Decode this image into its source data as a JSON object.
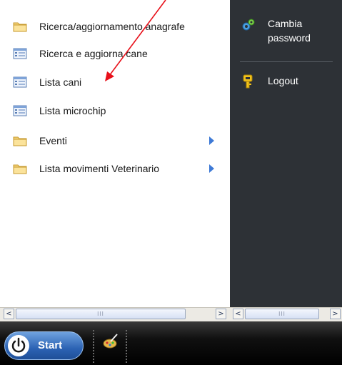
{
  "menu": {
    "items": [
      {
        "label": "Ricerca/aggiornamento anagrafe",
        "icon": "folder-icon",
        "submenu": false
      },
      {
        "label": "Ricerca e aggiorna cane",
        "icon": "list-window-icon",
        "submenu": false
      },
      {
        "label": "Lista cani",
        "icon": "list-window-icon",
        "submenu": false
      },
      {
        "label": "Lista microchip",
        "icon": "list-window-icon",
        "submenu": false
      },
      {
        "label": "Eventi",
        "icon": "folder-icon",
        "submenu": true
      },
      {
        "label": "Lista movimenti Veterinario",
        "icon": "folder-icon",
        "submenu": true
      }
    ]
  },
  "right_panel": {
    "change_password_label_line1": "Cambia",
    "change_password_label_line2": "password",
    "logout_label": "Logout"
  },
  "scrollbars": {
    "left_thumb_grip": "III",
    "right_thumb_grip": "III",
    "left_arrow": "<",
    "right_arrow": ">"
  },
  "taskbar": {
    "start_label": "Start"
  },
  "colors": {
    "right_panel_bg": "#2d3136",
    "accent_arrow": "#3e7ad6",
    "annotation_arrow": "#e8101a",
    "start_button": "#2c63b4"
  }
}
